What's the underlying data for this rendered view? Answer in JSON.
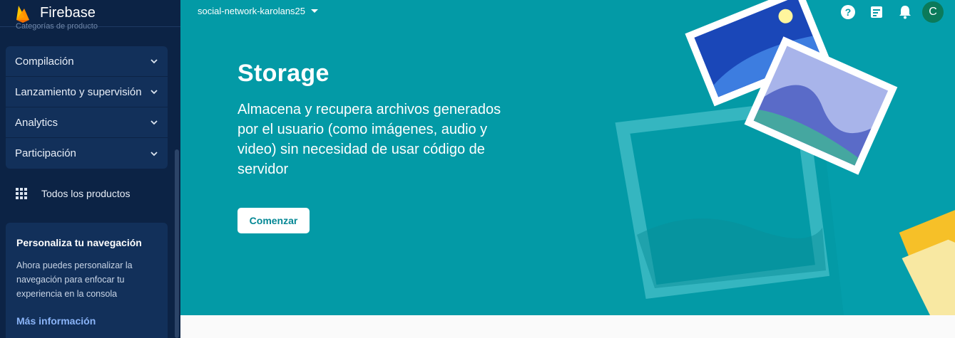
{
  "sidebar": {
    "brand": "Firebase",
    "cutoff_text": "Categorías de producto",
    "groups": [
      {
        "label": "Compilación"
      },
      {
        "label": "Lanzamiento y supervisión"
      },
      {
        "label": "Analytics"
      },
      {
        "label": "Participación"
      }
    ],
    "all_products": "Todos los productos",
    "promo": {
      "title": "Personaliza tu navegación",
      "text": "Ahora puedes personalizar la navegación para enfocar tu experiencia en la consola",
      "link": "Más información"
    }
  },
  "header": {
    "project": "social-network-karolans25",
    "icons": [
      "help-icon",
      "release-notes-icon",
      "notifications-icon"
    ],
    "avatar_initial": "C"
  },
  "hero": {
    "title": "Storage",
    "description": "Almacena y recupera archivos generados por el usuario (como imágenes, audio y video) sin necesidad de usar código de servidor",
    "cta": "Comenzar"
  },
  "colors": {
    "sidebar_bg": "#0c2345",
    "hero_bg": "#039aa6",
    "accent_link": "#8ab4f8",
    "avatar_bg": "#0b7a5a",
    "folder": "#f8e8a2"
  }
}
